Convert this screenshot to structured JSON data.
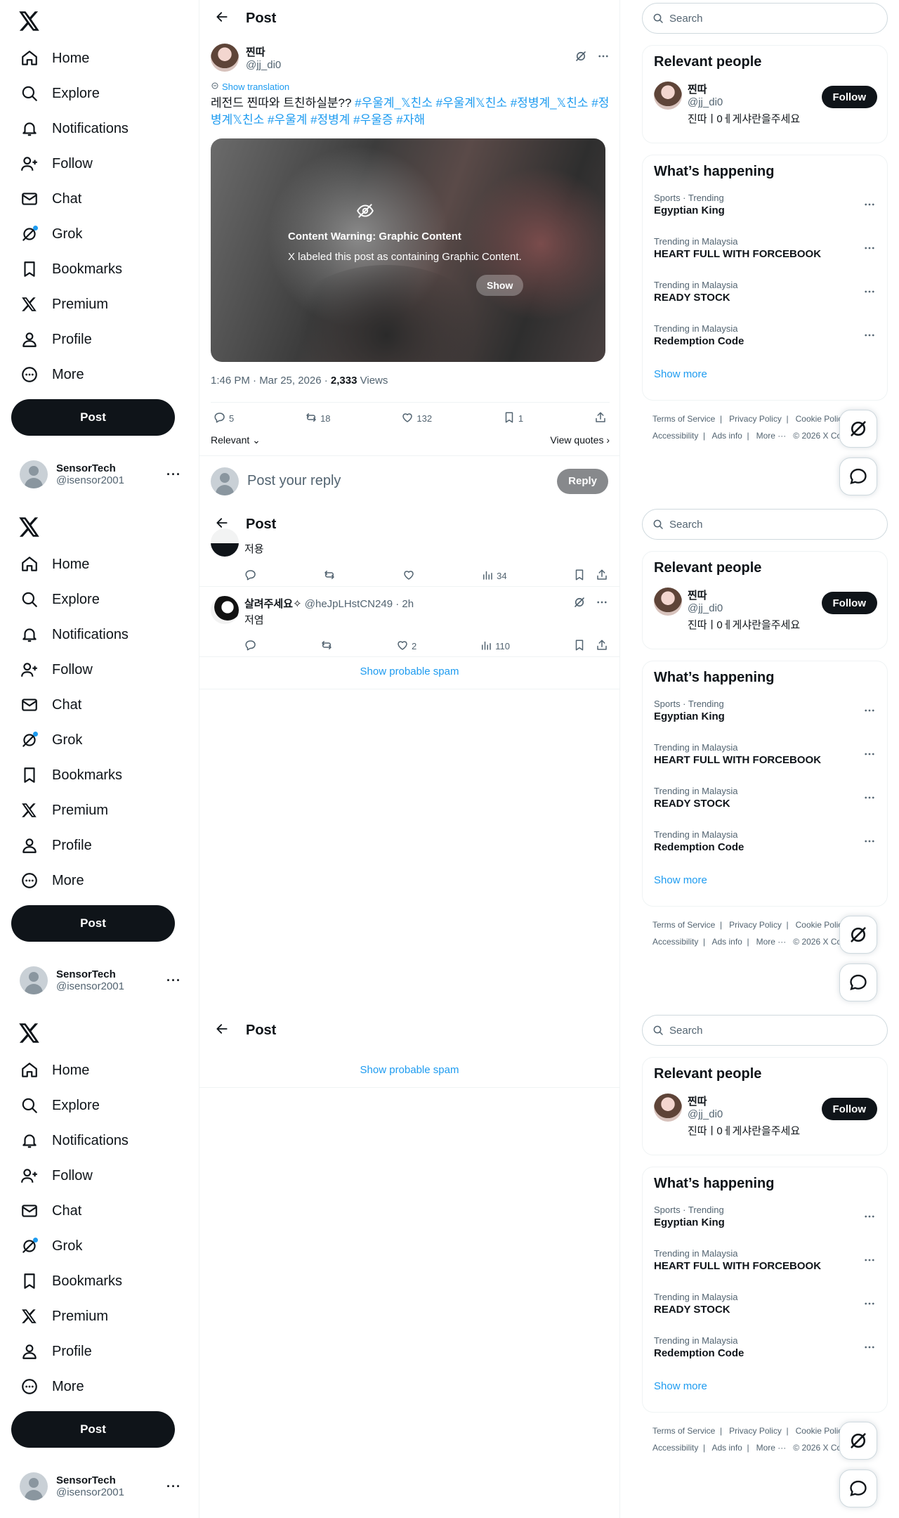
{
  "nav": {
    "items": [
      {
        "label": "Home",
        "icon": "home-icon"
      },
      {
        "label": "Explore",
        "icon": "search-icon"
      },
      {
        "label": "Notifications",
        "icon": "bell-icon"
      },
      {
        "label": "Follow",
        "icon": "person-add-icon"
      },
      {
        "label": "Chat",
        "icon": "envelope-icon"
      },
      {
        "label": "Grok",
        "icon": "grok-icon"
      },
      {
        "label": "Bookmarks",
        "icon": "bookmark-icon"
      },
      {
        "label": "Premium",
        "icon": "x-logo-icon"
      },
      {
        "label": "Profile",
        "icon": "person-icon"
      },
      {
        "label": "More",
        "icon": "more-circle-icon"
      }
    ],
    "post_label": "Post"
  },
  "account": {
    "name": "SensorTech",
    "handle": "@isensor2001",
    "more": "···"
  },
  "header": {
    "title": "Post"
  },
  "post": {
    "author_name": "찐따",
    "author_handle": "@jj_di0",
    "show_translation": "Show translation",
    "text_plain": "레전드 찐따와 트친하실분?? ",
    "text_tags": "#우울계_𝕏친소 #우울계𝕏친소 #정병계_𝕏친소 #정병계𝕏친소 #우울계 #정병계 #우울증 #자해",
    "content_warning_title": "Content Warning: Graphic Content",
    "content_warning_text": "X labeled this post as containing Graphic Content.",
    "show_label": "Show",
    "time": "1:46 PM · Mar 25, 2026 · ",
    "views_count": "2,333",
    "views_label": " Views",
    "replies": "5",
    "reposts": "18",
    "likes": "132",
    "bookmarks": "1",
    "sort_label": "Relevant",
    "view_quotes": "View quotes"
  },
  "reply_box": {
    "placeholder": "Post your reply",
    "button": "Reply"
  },
  "replies": [
    {
      "text": "저용",
      "views": "34",
      "likes": "",
      "name": "",
      "handle": "",
      "time": ""
    },
    {
      "name": "살려주세요✧",
      "handle": "@heJpLHstCN249",
      "time": "· 2h",
      "text": "저염",
      "likes": "2",
      "views": "110"
    }
  ],
  "show_spam": "Show probable spam",
  "right": {
    "search_placeholder": "Search",
    "relevant_people_title": "Relevant people",
    "person": {
      "name": "찐따",
      "handle": "@jj_di0",
      "bio": "진따ㅣ0ㅔ게샤란을주세요",
      "follow": "Follow"
    },
    "happening_title": "What’s happening",
    "trends": [
      {
        "meta": "Sports · Trending",
        "title": "Egyptian King"
      },
      {
        "meta": "Trending in Malaysia",
        "title": "HEART FULL WITH FORCEBOOK"
      },
      {
        "meta": "Trending in Malaysia",
        "title": "READY STOCK"
      },
      {
        "meta": "Trending in Malaysia",
        "title": "Redemption Code"
      }
    ],
    "show_more": "Show more",
    "footer_line1": "Terms of Service  |   Privacy Policy  |   Cookie Policy",
    "footer_line2": "Accessibility  |   Ads info  |   More ···   © 2026 X Corp."
  }
}
